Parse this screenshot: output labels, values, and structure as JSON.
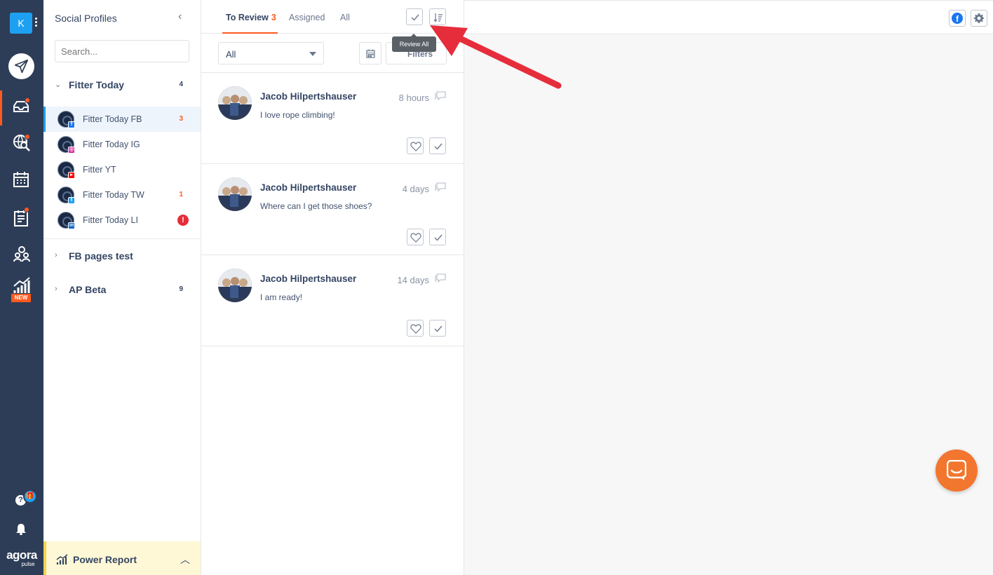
{
  "account": {
    "initial": "K"
  },
  "rail": {
    "new_badge": "NEW",
    "help_glyph": "?",
    "gift_glyph": "🎁",
    "logo_main": "agora",
    "logo_sub": "pulse",
    "icons": [
      "publish-icon",
      "inbox-icon",
      "listening-icon",
      "calendar-icon",
      "planner-icon",
      "team-icon",
      "reports-icon",
      "help-icon",
      "bell-icon"
    ]
  },
  "profiles": {
    "title": "Social Profiles",
    "collapse_glyph": "‹",
    "search_placeholder": "Search...",
    "groups": [
      {
        "name": "Fitter Today",
        "count": "4",
        "expanded": true,
        "items": [
          {
            "name": "Fitter Today FB",
            "network": "facebook",
            "count": "3",
            "selected": true
          },
          {
            "name": "Fitter Today IG",
            "network": "instagram",
            "count": ""
          },
          {
            "name": "Fitter YT",
            "network": "youtube",
            "count": ""
          },
          {
            "name": "Fitter Today TW",
            "network": "twitter",
            "count": "1"
          },
          {
            "name": "Fitter Today LI",
            "network": "linkedin",
            "count": "",
            "error": "!"
          }
        ]
      },
      {
        "name": "FB pages test",
        "count": "",
        "expanded": false
      },
      {
        "name": "AP Beta",
        "count": "9",
        "expanded": false
      }
    ],
    "power_report": "Power Report"
  },
  "inbox": {
    "tabs": [
      {
        "label": "To Review",
        "count": "3",
        "active": true
      },
      {
        "label": "Assigned",
        "count": "",
        "active": false
      },
      {
        "label": "All",
        "count": "",
        "active": false
      }
    ],
    "tooltip": "Review All",
    "filter_select": "All",
    "filters_label": "Filters",
    "items": [
      {
        "author": "Jacob Hilpertshauser",
        "time": "8 hours",
        "message": "I love rope climbing!"
      },
      {
        "author": "Jacob Hilpertshauser",
        "time": "4 days",
        "message": "Where can I get those shoes?"
      },
      {
        "author": "Jacob Hilpertshauser",
        "time": "14 days",
        "message": "I am ready!"
      }
    ]
  },
  "detail": {
    "fb_glyph": "f"
  },
  "colors": {
    "rail": "#2e3d57",
    "accent": "#ff5a1f",
    "selected": "#1ea0f2",
    "annotation_arrow": "#e62d3b"
  }
}
